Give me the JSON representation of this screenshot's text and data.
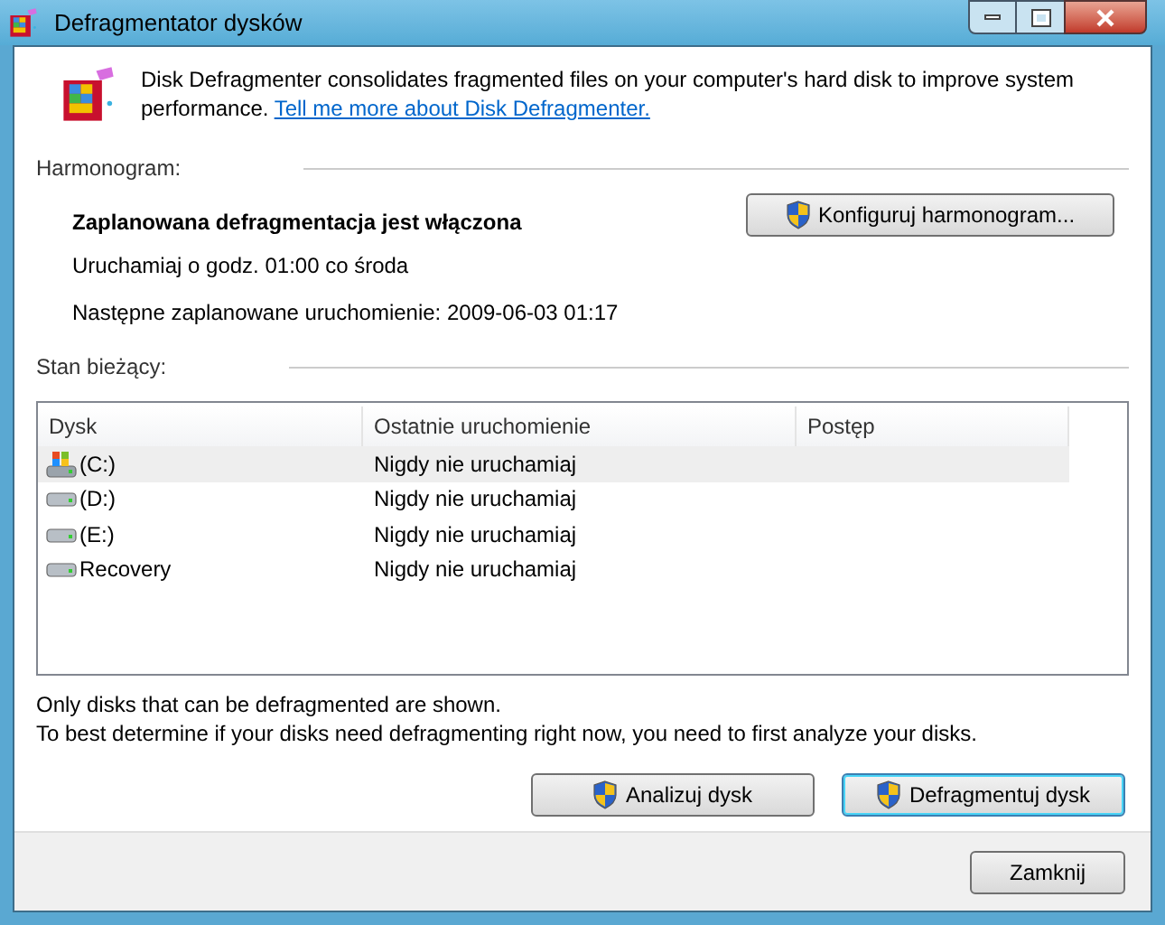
{
  "window": {
    "title": "Defragmentator dysków"
  },
  "intro": {
    "text": "Disk Defragmenter consolidates fragmented files on your computer's hard disk to improve system performance.",
    "link": "Tell me more about Disk Defragmenter."
  },
  "schedule": {
    "heading": "Harmonogram:",
    "status": "Zaplanowana defragmentacja jest włączona",
    "run_at": "Uruchamiaj o godz. 01:00 co środa",
    "next_run": "Następne zaplanowane uruchomienie: 2009-06-03 01:17",
    "button": "Konfiguruj harmonogram..."
  },
  "current": {
    "heading": "Stan bieżący:"
  },
  "table": {
    "columns": [
      "Dysk",
      "Ostatnie uruchomienie",
      "Postęp"
    ],
    "rows": [
      {
        "kind": "system",
        "disk": "(C:)",
        "last_run": "Nigdy nie uruchamiaj",
        "selected": true
      },
      {
        "kind": "drive",
        "disk": "(D:)",
        "last_run": "Nigdy nie uruchamiaj",
        "selected": false
      },
      {
        "kind": "drive",
        "disk": "(E:)",
        "last_run": "Nigdy nie uruchamiaj",
        "selected": false
      },
      {
        "kind": "drive",
        "disk": "Recovery",
        "last_run": "Nigdy nie uruchamiaj",
        "selected": false
      }
    ]
  },
  "notes": [
    "Only disks that can be defragmented are shown.",
    "To best determine if your disks need defragmenting right now, you need to first analyze your disks."
  ],
  "actions": [
    {
      "label": "Analizuj dysk",
      "default": false
    },
    {
      "label": "Defragmentuj dysk",
      "default": true
    }
  ],
  "close_button": "Zamknij"
}
